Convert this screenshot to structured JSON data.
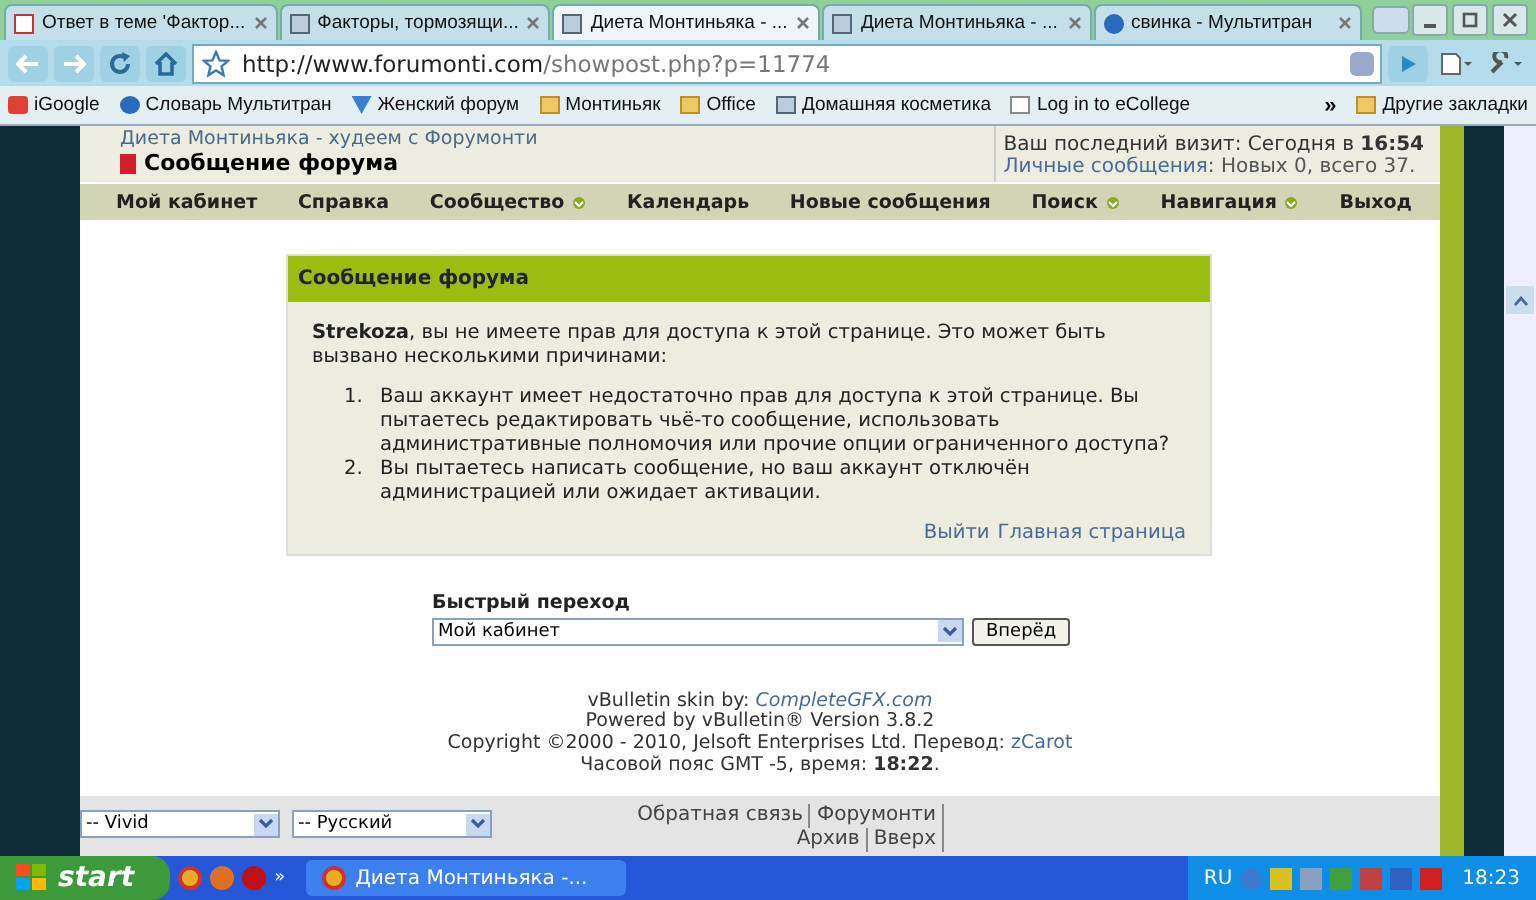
{
  "browser": {
    "tabs": [
      {
        "title": "Ответ в теме 'Фактор...",
        "selected": false
      },
      {
        "title": "Факторы, тормозящи...",
        "selected": false
      },
      {
        "title": "Диета Монтиньяка - ...",
        "selected": true
      },
      {
        "title": "Диета Монтиньяка - ...",
        "selected": false
      },
      {
        "title": "свинка - Мультитран",
        "selected": false
      }
    ],
    "url_host": "http://www.forumonti.com",
    "url_path": "/showpost.php?p=11774",
    "bookmarks": [
      "iGoogle",
      "Словарь Мультитран",
      "Женский форум",
      "Монтиньяк",
      "Office",
      "Домашняя косметика",
      "Log in to eCollege"
    ],
    "more": "»",
    "other_bookmarks": "Другие закладки"
  },
  "header": {
    "breadcrumb": "Диета Монтиньяка - худеем с Форумонти",
    "title": "Сообщение форума",
    "last_visit_label": "Ваш последний визит: Сегодня в ",
    "last_visit_time": "16:54",
    "pm_link": "Личные сообщения",
    "pm_text": ": Новых 0, всего 37."
  },
  "nav": [
    {
      "label": "Мой кабинет",
      "dropdown": false
    },
    {
      "label": "Справка",
      "dropdown": false
    },
    {
      "label": "Сообщество",
      "dropdown": true
    },
    {
      "label": "Календарь",
      "dropdown": false
    },
    {
      "label": "Новые сообщения",
      "dropdown": false
    },
    {
      "label": "Поиск",
      "dropdown": true
    },
    {
      "label": "Навигация",
      "dropdown": true
    },
    {
      "label": "Выход",
      "dropdown": false
    }
  ],
  "message": {
    "title": "Сообщение форума",
    "intro": "**Strekoza**, вы не имеете прав для доступа к этой странице. Это может быть вызвано несколькими причинами:",
    "reasons": [
      {
        "number": "1.",
        "text": "Ваш аккаунт имеет недостаточно прав для доступа к этой странице. Вы пытаетесь редактировать чьё-то сообщение, использовать административные полномочия или прочие опции ограниченного доступа?"
      },
      {
        "number": "2.",
        "text": "Вы пытаетесь написать сообщение, но ваш аккаунт отключён администрацией или ожидает активации."
      }
    ],
    "links": [
      "Выйти",
      "Главная страница"
    ]
  },
  "quick_jump": {
    "label": "Быстрый переход",
    "value": "Мой кабинет",
    "button": "Вперёд"
  },
  "footer": {
    "skin": "vBulletin skin by: ",
    "skin_link": "CompleteGFX.com",
    "powered": "Powered by vBulletin® Version 3.8.2",
    "copyright": "Copyright ©2000 - 2010, Jelsoft Enterprises Ltd. Перевод: ",
    "translator": "zCarot",
    "timezone": "Часовой пояс GMT -5, время: **18:22**."
  },
  "bottom_bar": {
    "style_select": "-- Vivid",
    "lang_select": "-- Русский",
    "links": [
      "Обратная связь",
      "Форумонти",
      "Архив",
      "Вверх"
    ]
  },
  "taskbar": {
    "start": "start",
    "more": "»",
    "task": "Диета Монтиньяка -...",
    "lang": "RU",
    "clock": "18:23"
  }
}
